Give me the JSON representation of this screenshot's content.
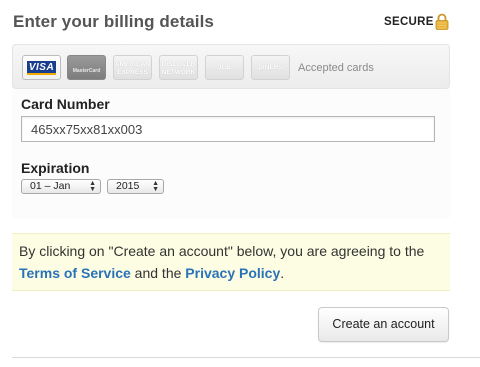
{
  "header": {
    "title": "Enter your billing details",
    "secure_label": "SECURE"
  },
  "cards": {
    "items": [
      {
        "name": "VISA"
      },
      {
        "name": "MasterCard"
      },
      {
        "name": "AMERICAN EXPRESS"
      },
      {
        "name": "DISCOVER NETWORK"
      },
      {
        "name": "JCB"
      },
      {
        "name": "DINERS"
      }
    ],
    "accepted_label": "Accepted cards"
  },
  "card_number": {
    "label": "Card Number",
    "value": "465xx75xx81xx003"
  },
  "expiration": {
    "label": "Expiration",
    "month_value": "01 – Jan",
    "year_value": "2015"
  },
  "notice": {
    "text_before": "By clicking on \"Create an account\" below, you are agreeing to the",
    "terms_link": "Terms of Service",
    "text_middle": " and the ",
    "privacy_link": "Privacy Policy",
    "text_end": "."
  },
  "actions": {
    "create_label": "Create an account"
  },
  "colors": {
    "link": "#2a73b8",
    "notice_background": "#fdfde3",
    "lock": "#e8b33a"
  },
  "icons": {
    "lock": "lock-icon"
  }
}
